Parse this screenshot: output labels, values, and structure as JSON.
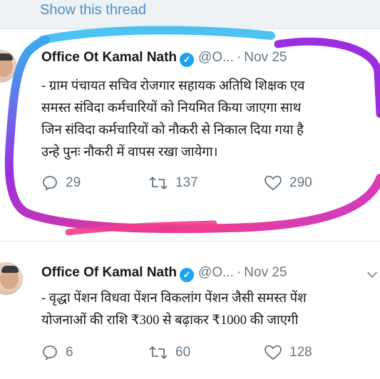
{
  "thread_link": "Show this thread",
  "tweets": [
    {
      "name": "Office Ot Kamal Nath",
      "handle": "@O...",
      "date": "Nov 25",
      "lines": [
        "- ग्राम पंचायत सचिव रोजगार सहायक अतिथि शिक्षक एव",
        "समस्त संविदा कर्मचारियों को नियमित किया जाएगा साथ",
        "जिन संविदा कर्मचारियों को नौकरी से निकाल दिया गया है",
        "उन्हे पुनः नौकरी में वापस रखा जायेगा।"
      ],
      "replies": "29",
      "retweets": "137",
      "likes": "290"
    },
    {
      "name": "Office Of Kamal Nath",
      "handle": "@O...",
      "date": "Nov 25",
      "lines": [
        "- वृद्धा पेंशन विधवा पेंशन विकलांग पेंशन जैसी समस्त पेंश",
        "योजनाओं की राशि ₹300 से बढ़ाकर ₹1000 की जाएगी"
      ],
      "replies": "6",
      "retweets": "60",
      "likes": "128"
    }
  ],
  "colors": {
    "link": "#4a90c9",
    "verified": "#1da1f2",
    "muted": "#657786",
    "marker_purple": "#9b2fe0",
    "marker_pink": "#f03c8c",
    "marker_blue": "#2fb8f0"
  }
}
